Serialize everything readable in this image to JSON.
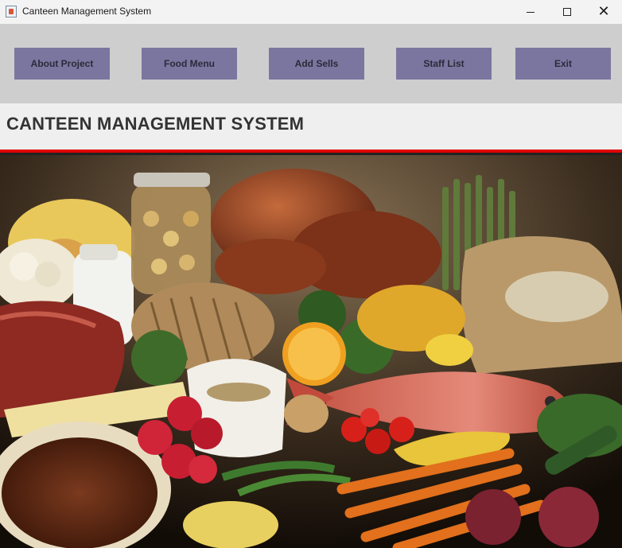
{
  "window": {
    "title": "Canteen Management System",
    "icon": "java-cup-icon",
    "controls": [
      "minimize",
      "maximize",
      "close"
    ]
  },
  "toolbar": {
    "buttons": [
      {
        "label": "About Project"
      },
      {
        "label": "Food Menu"
      },
      {
        "label": "Add Sells"
      },
      {
        "label": "Staff List"
      },
      {
        "label": "Exit"
      }
    ],
    "button_color": "#7b769f",
    "background_color": "#cecece"
  },
  "header": {
    "title": "CANTEEN MANAGEMENT SYSTEM",
    "accent_color": "#e00000"
  },
  "hero_image": {
    "subject": "assorted groceries photo"
  }
}
